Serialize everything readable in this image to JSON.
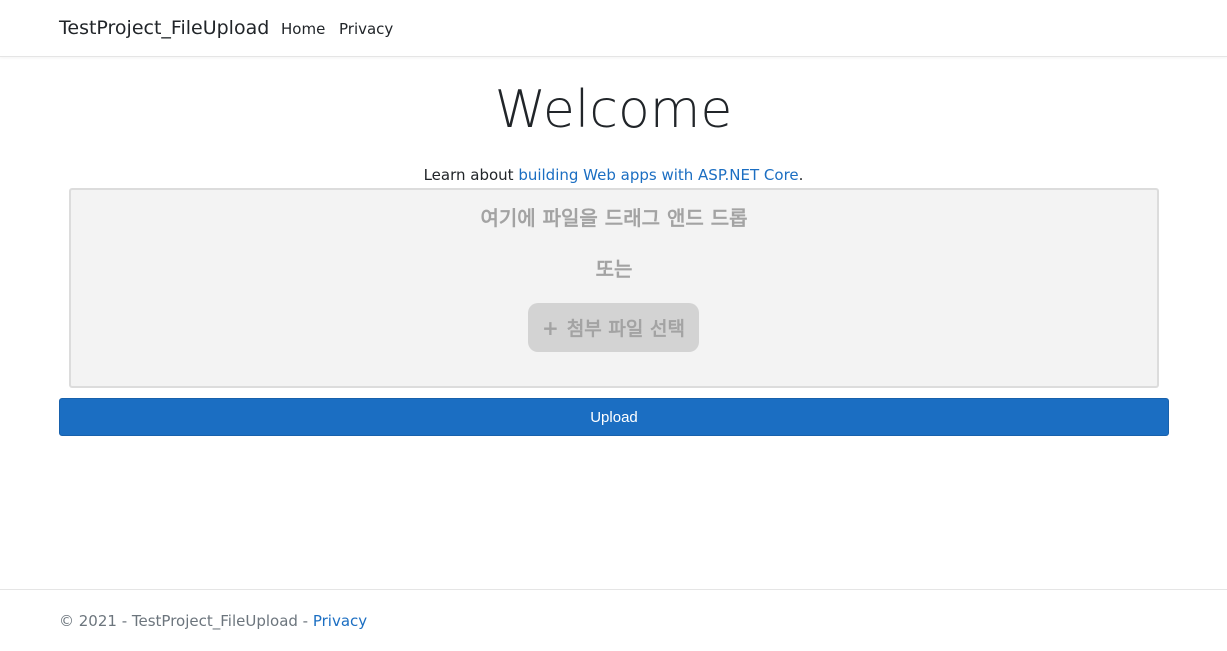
{
  "navbar": {
    "brand": "TestProject_FileUpload",
    "links": [
      {
        "label": "Home"
      },
      {
        "label": "Privacy"
      }
    ]
  },
  "main": {
    "title": "Welcome",
    "learn_prefix": "Learn about ",
    "learn_link": "building Web apps with ASP.NET Core",
    "learn_suffix": ".",
    "dropzone": {
      "title": "여기에 파일을 드래그 앤드 드롭",
      "or": "또는",
      "button_icon": "+",
      "button_label": "첨부 파일 선택"
    },
    "upload_label": "Upload"
  },
  "footer": {
    "copyright": "© 2021 - TestProject_FileUpload - ",
    "privacy_link": "Privacy"
  },
  "colors": {
    "accent": "#1b6ec2",
    "dropzone_bg": "#f3f3f3",
    "dropzone_text": "#a3a3a3"
  }
}
